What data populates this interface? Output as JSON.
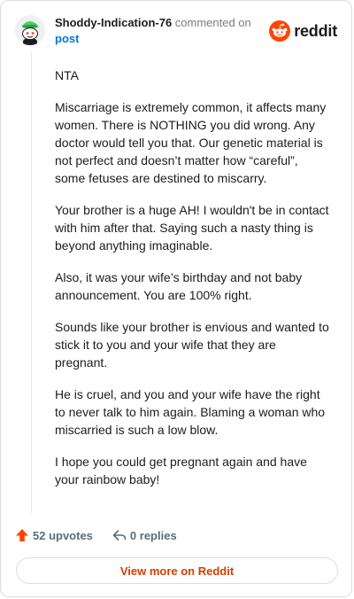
{
  "comment": {
    "username": "Shoddy-Indication-76",
    "action_text": "commented on",
    "post_link": "post",
    "brand": "reddit",
    "paragraphs": [
      "NTA",
      "Miscarriage is extremely common, it affects many women. There is NOTHING you did wrong. Any doctor would tell you that. Our genetic material is not perfect and doesn’t matter how “careful”, some fetuses are destined to miscarry.",
      "Your brother is a huge AH! I wouldn't be in contact with him after that. Saying such a nasty thing is beyond anything imaginable.",
      "Also, it was your wife’s birthday and not baby announcement. You are 100% right.",
      "Sounds like your brother is envious and wanted to stick it to you and your wife that they are pregnant.",
      "He is cruel, and you and your wife have the right to never talk to him again. Blaming a woman who miscarried is such a low blow.",
      "I hope you could get pregnant again and have your rainbow baby!"
    ],
    "upvotes": "52 upvotes",
    "replies": "0 replies",
    "view_more": "View more on Reddit"
  },
  "colors": {
    "brand_orange": "#ff4500",
    "link_blue": "#0079d3",
    "view_more": "#d93a00",
    "avatar_green": "#46d160"
  },
  "icons": [
    "avatar-snoo-icon",
    "reddit-logo-icon",
    "upvote-arrow-icon",
    "reply-arrow-icon"
  ]
}
